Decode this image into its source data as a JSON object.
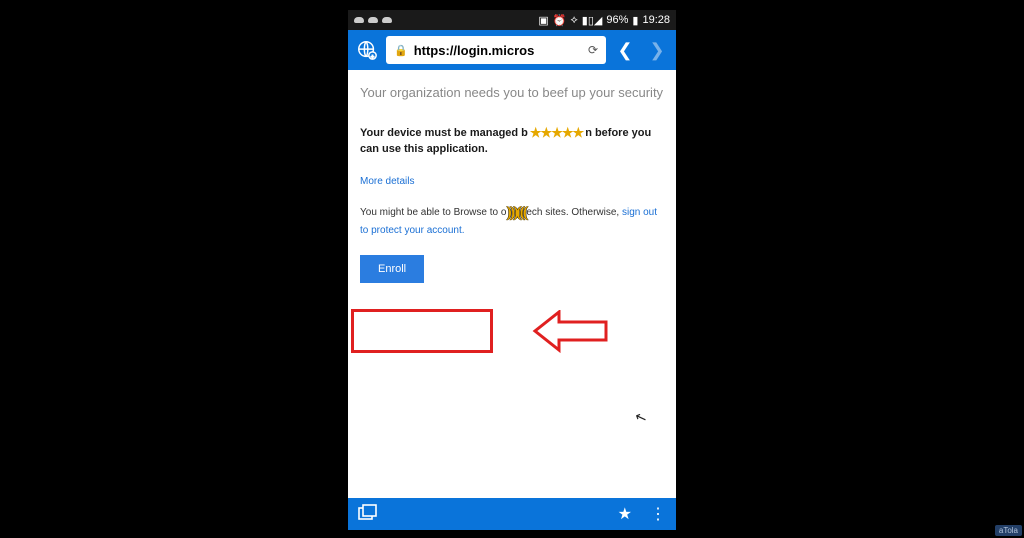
{
  "status": {
    "battery_pct": "96%",
    "time": "19:28"
  },
  "browser": {
    "url_display": "https://login.micros"
  },
  "page": {
    "heading": "Your organization needs you to beef up your security",
    "body_pre": "Your device must be managed b",
    "body_redacted": "★★★★★",
    "body_post": "n before you can use this application.",
    "more_details": "More details",
    "hint_pre": "You might be able to Browse to o",
    "hint_mid": ")))(((",
    "hint_post": "ech sites. Otherwise, ",
    "signout_label": "sign out to protect your account.",
    "enroll_label": "Enroll"
  },
  "watermark": "aTola"
}
